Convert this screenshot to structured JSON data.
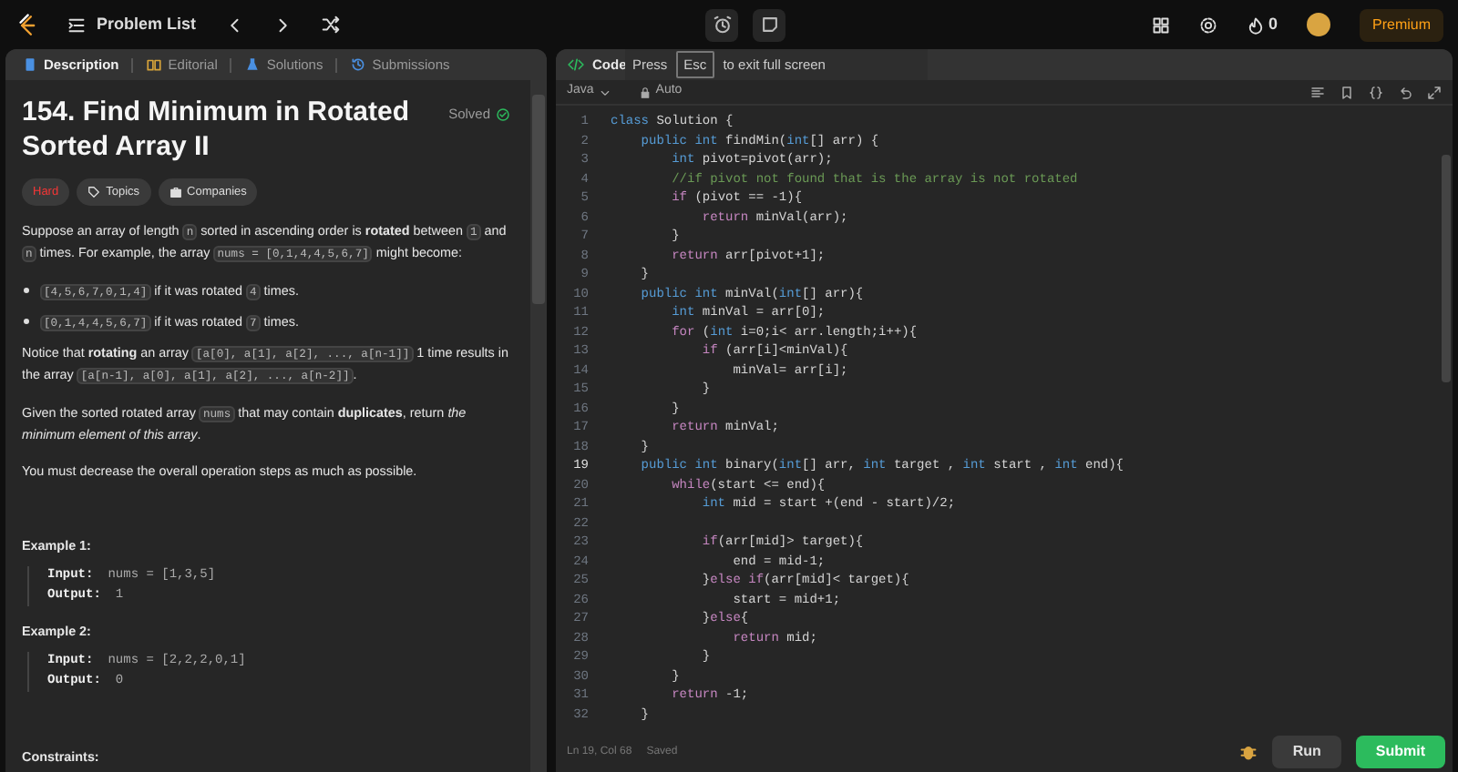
{
  "top_bar": {
    "problem_list": "Problem List",
    "streak": "0",
    "premium": "Premium"
  },
  "left_tabs": [
    {
      "label": "Description",
      "selected": true
    },
    {
      "label": "Editorial",
      "selected": false
    },
    {
      "label": "Solutions",
      "selected": false
    },
    {
      "label": "Submissions",
      "selected": false
    }
  ],
  "problem": {
    "title": "154. Find Minimum in Rotated Sorted Array II",
    "status": "Solved",
    "difficulty": "Hard",
    "tags": [
      "Topics",
      "Companies"
    ],
    "blocks": [
      {
        "kind": "paragraph",
        "parts": [
          {
            "kind": "text",
            "text": "Suppose an array of length "
          },
          {
            "kind": "code",
            "text": "n"
          },
          {
            "kind": "text",
            "text": " sorted in ascending order is "
          },
          {
            "kind": "bold",
            "text": "rotated"
          },
          {
            "kind": "text",
            "text": " between "
          },
          {
            "kind": "code",
            "text": "1"
          },
          {
            "kind": "text",
            "text": " and "
          },
          {
            "kind": "code",
            "text": "n"
          },
          {
            "kind": "text",
            "text": " times. For example, the array "
          },
          {
            "kind": "code",
            "text": "nums = [0,1,4,4,5,6,7]"
          },
          {
            "kind": "text",
            "text": " might become:"
          }
        ]
      },
      {
        "kind": "bullet",
        "parts": [
          {
            "kind": "code",
            "text": "[4,5,6,7,0,1,4]"
          },
          {
            "kind": "text",
            "text": " if it was rotated "
          },
          {
            "kind": "code",
            "text": "4"
          },
          {
            "kind": "text",
            "text": " times."
          }
        ]
      },
      {
        "kind": "bullet",
        "parts": [
          {
            "kind": "code",
            "text": "[0,1,4,4,5,6,7]"
          },
          {
            "kind": "text",
            "text": " if it was rotated "
          },
          {
            "kind": "code",
            "text": "7"
          },
          {
            "kind": "text",
            "text": " times."
          }
        ]
      },
      {
        "kind": "paragraph",
        "parts": [
          {
            "kind": "text",
            "text": "Notice that "
          },
          {
            "kind": "bold",
            "text": "rotating"
          },
          {
            "kind": "text",
            "text": " an array "
          },
          {
            "kind": "code",
            "text": "[a[0], a[1], a[2], ..., a[n-1]]"
          },
          {
            "kind": "text",
            "text": " 1 time results in the array "
          },
          {
            "kind": "code",
            "text": "[a[n-1], a[0], a[1], a[2], ..., a[n-2]]"
          },
          {
            "kind": "text",
            "text": "."
          }
        ]
      },
      {
        "kind": "paragraph",
        "parts": [
          {
            "kind": "text",
            "text": "Given the sorted rotated array "
          },
          {
            "kind": "code",
            "text": "nums"
          },
          {
            "kind": "text",
            "text": " that may contain "
          },
          {
            "kind": "bold",
            "text": "duplicates"
          },
          {
            "kind": "text",
            "text": ", return "
          },
          {
            "kind": "italic",
            "text": "the minimum element of this array"
          },
          {
            "kind": "text",
            "text": "."
          }
        ]
      },
      {
        "kind": "paragraph",
        "parts": [
          {
            "kind": "text",
            "text": "You must decrease the overall operation steps as much as possible."
          }
        ]
      },
      {
        "kind": "heading",
        "text": "Example 1:"
      },
      {
        "kind": "example",
        "rows": [
          {
            "label": "Input:",
            "value": "nums = [1,3,5]"
          },
          {
            "label": "Output:",
            "value": "1"
          }
        ]
      },
      {
        "kind": "heading",
        "text": "Example 2:"
      },
      {
        "kind": "example",
        "rows": [
          {
            "label": "Input:",
            "value": "nums = [2,2,2,0,1]"
          },
          {
            "label": "Output:",
            "value": "0"
          }
        ]
      },
      {
        "kind": "heading",
        "text": "Constraints:"
      }
    ]
  },
  "code_panel": {
    "title": "Code",
    "language": "Java",
    "mode": "Auto",
    "overlay": {
      "before": "Press",
      "key": "Esc",
      "after": "to exit full screen"
    }
  },
  "code": {
    "lines": [
      {
        "number": "1",
        "current": false,
        "tokens": [
          {
            "kind": "type",
            "text": "class"
          },
          {
            "kind": "plain",
            "text": " Solution {"
          }
        ]
      },
      {
        "number": "2",
        "current": false,
        "tokens": [
          {
            "kind": "type",
            "text": "    public int"
          },
          {
            "kind": "plain",
            "text": " findMin("
          },
          {
            "kind": "type",
            "text": "int"
          },
          {
            "kind": "plain",
            "text": "[] arr) {"
          }
        ]
      },
      {
        "number": "3",
        "current": false,
        "tokens": [
          {
            "kind": "type",
            "text": "        int"
          },
          {
            "kind": "plain",
            "text": " pivot=pivot(arr);"
          }
        ]
      },
      {
        "number": "4",
        "current": false,
        "tokens": [
          {
            "kind": "comment",
            "text": "        //if pivot not found that is the array is not rotated"
          }
        ]
      },
      {
        "number": "5",
        "current": false,
        "tokens": [
          {
            "kind": "keyword",
            "text": "        if"
          },
          {
            "kind": "plain",
            "text": " (pivot == -1){"
          }
        ]
      },
      {
        "number": "6",
        "current": false,
        "tokens": [
          {
            "kind": "keyword",
            "text": "            return"
          },
          {
            "kind": "plain",
            "text": " minVal(arr);"
          }
        ]
      },
      {
        "number": "7",
        "current": false,
        "tokens": [
          {
            "kind": "plain",
            "text": "        }"
          }
        ]
      },
      {
        "number": "8",
        "current": false,
        "tokens": [
          {
            "kind": "keyword",
            "text": "        return"
          },
          {
            "kind": "plain",
            "text": " arr[pivot+1];"
          }
        ]
      },
      {
        "number": "9",
        "current": false,
        "tokens": [
          {
            "kind": "plain",
            "text": "    }"
          }
        ]
      },
      {
        "number": "10",
        "current": false,
        "tokens": [
          {
            "kind": "type",
            "text": "    public int"
          },
          {
            "kind": "plain",
            "text": " minVal("
          },
          {
            "kind": "type",
            "text": "int"
          },
          {
            "kind": "plain",
            "text": "[] arr){"
          }
        ]
      },
      {
        "number": "11",
        "current": false,
        "tokens": [
          {
            "kind": "type",
            "text": "        int"
          },
          {
            "kind": "plain",
            "text": " minVal = arr[0];"
          }
        ]
      },
      {
        "number": "12",
        "current": false,
        "tokens": [
          {
            "kind": "keyword",
            "text": "        for"
          },
          {
            "kind": "plain",
            "text": " ("
          },
          {
            "kind": "type",
            "text": "int"
          },
          {
            "kind": "plain",
            "text": " i=0;i< arr.length;i++){"
          }
        ]
      },
      {
        "number": "13",
        "current": false,
        "tokens": [
          {
            "kind": "keyword",
            "text": "            if"
          },
          {
            "kind": "plain",
            "text": " (arr[i]<minVal){"
          }
        ]
      },
      {
        "number": "14",
        "current": false,
        "tokens": [
          {
            "kind": "plain",
            "text": "                minVal= arr[i];"
          }
        ]
      },
      {
        "number": "15",
        "current": false,
        "tokens": [
          {
            "kind": "plain",
            "text": "            }"
          }
        ]
      },
      {
        "number": "16",
        "current": false,
        "tokens": [
          {
            "kind": "plain",
            "text": "        }"
          }
        ]
      },
      {
        "number": "17",
        "current": false,
        "tokens": [
          {
            "kind": "keyword",
            "text": "        return"
          },
          {
            "kind": "plain",
            "text": " minVal;"
          }
        ]
      },
      {
        "number": "18",
        "current": false,
        "tokens": [
          {
            "kind": "plain",
            "text": "    }"
          }
        ]
      },
      {
        "number": "19",
        "current": true,
        "tokens": [
          {
            "kind": "type",
            "text": "    public int"
          },
          {
            "kind": "plain",
            "text": " binary("
          },
          {
            "kind": "type",
            "text": "int"
          },
          {
            "kind": "plain",
            "text": "[] arr, "
          },
          {
            "kind": "type",
            "text": "int"
          },
          {
            "kind": "plain",
            "text": " target , "
          },
          {
            "kind": "type",
            "text": "int"
          },
          {
            "kind": "plain",
            "text": " start , "
          },
          {
            "kind": "type",
            "text": "int"
          },
          {
            "kind": "plain",
            "text": " end){"
          }
        ]
      },
      {
        "number": "20",
        "current": false,
        "tokens": [
          {
            "kind": "keyword",
            "text": "        while"
          },
          {
            "kind": "plain",
            "text": "(start <= end){"
          }
        ]
      },
      {
        "number": "21",
        "current": false,
        "tokens": [
          {
            "kind": "type",
            "text": "            int"
          },
          {
            "kind": "plain",
            "text": " mid = start +(end - start)/2;"
          }
        ]
      },
      {
        "number": "22",
        "current": false
      },
      {
        "number": "23",
        "current": false,
        "tokens": [
          {
            "kind": "keyword",
            "text": "            if"
          },
          {
            "kind": "plain",
            "text": "(arr[mid]> target){"
          }
        ]
      },
      {
        "number": "24",
        "current": false,
        "tokens": [
          {
            "kind": "plain",
            "text": "                end = mid-1;"
          }
        ]
      },
      {
        "number": "25",
        "current": false,
        "tokens": [
          {
            "kind": "plain",
            "text": "            }"
          },
          {
            "kind": "keyword",
            "text": "else if"
          },
          {
            "kind": "plain",
            "text": "(arr[mid]< target){"
          }
        ]
      },
      {
        "number": "26",
        "current": false,
        "tokens": [
          {
            "kind": "plain",
            "text": "                start = mid+1;"
          }
        ]
      },
      {
        "number": "27",
        "current": false,
        "tokens": [
          {
            "kind": "plain",
            "text": "            }"
          },
          {
            "kind": "keyword",
            "text": "else"
          },
          {
            "kind": "plain",
            "text": "{"
          }
        ]
      },
      {
        "number": "28",
        "current": false,
        "tokens": [
          {
            "kind": "keyword",
            "text": "                return"
          },
          {
            "kind": "plain",
            "text": " mid;"
          }
        ]
      },
      {
        "number": "29",
        "current": false,
        "tokens": [
          {
            "kind": "plain",
            "text": "            }"
          }
        ]
      },
      {
        "number": "30",
        "current": false,
        "tokens": [
          {
            "kind": "plain",
            "text": "        }"
          }
        ]
      },
      {
        "number": "31",
        "current": false,
        "tokens": [
          {
            "kind": "keyword",
            "text": "        return"
          },
          {
            "kind": "plain",
            "text": " -1;"
          }
        ]
      },
      {
        "number": "32",
        "current": false,
        "tokens": [
          {
            "kind": "plain",
            "text": "    }"
          }
        ]
      }
    ]
  },
  "status_bar": {
    "position": "Ln 19, Col 68",
    "saved": "Saved",
    "run": "Run",
    "submit": "Submit"
  }
}
